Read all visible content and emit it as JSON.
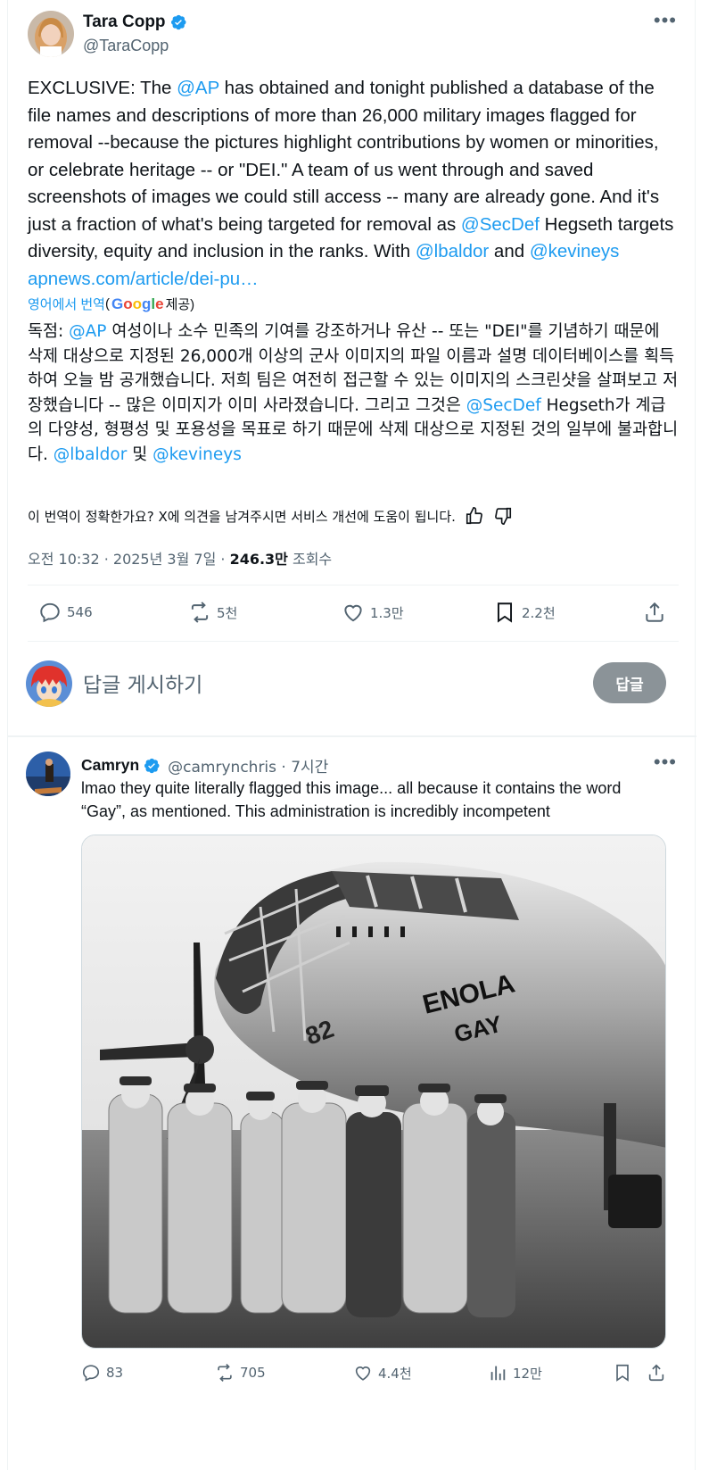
{
  "main_tweet": {
    "display_name": "Tara Copp",
    "handle": "@TaraCopp",
    "text_segments": [
      {
        "t": "EXCLUSIVE: The ",
        "link": false
      },
      {
        "t": "@AP",
        "link": true
      },
      {
        "t": "  has obtained and tonight published a database of the file names and descriptions of more than 26,000 military images flagged for removal --because the pictures highlight contributions by women or minorities, or celebrate heritage -- or \"DEI.\" A team of us went through and saved screenshots of images we could still access -- many are already gone. And it's just a fraction of what's being targeted for removal as ",
        "link": false
      },
      {
        "t": "@SecDef",
        "link": true
      },
      {
        "t": " Hegseth targets diversity, equity and inclusion in the ranks. With ",
        "link": false
      },
      {
        "t": "@lbaldor",
        "link": true
      },
      {
        "t": " and ",
        "link": false
      },
      {
        "t": "@kevineys",
        "link": true
      },
      {
        "t": " ",
        "link": false
      },
      {
        "t": "apnews.com/article/dei-pu…",
        "link": true
      }
    ],
    "translate_label": "영어에서 번역",
    "translate_paren_open": "(",
    "google_letters": [
      "G",
      "o",
      "o",
      "g",
      "l",
      "e"
    ],
    "translate_provided": " 제공)",
    "ko_segments": [
      {
        "t": "독점: ",
        "link": false
      },
      {
        "t": "@AP",
        "link": true
      },
      {
        "t": " 여성이나 소수 민족의 기여를 강조하거나 유산 -- 또는 \"DEI\"를 기념하기 때문에 삭제 대상으로 지정된 26,000개 이상의 군사 이미지의 파일 이름과 설명 데이터베이스를 획득하여 오늘 밤 공개했습니다. 저희 팀은 여전히 접근할 수 있는 이미지의 스크린샷을 살펴보고 저장했습니다 -- 많은 이미지가 이미 사라졌습니다. 그리고 그것은 ",
        "link": false
      },
      {
        "t": "@SecDef",
        "link": true
      },
      {
        "t": " Hegseth가 계급의 다양성, 형평성 및 포용성을 목표로 하기 때문에 삭제 대상으로 지정된 것의 일부에 불과합니다. ",
        "link": false
      },
      {
        "t": "@lbaldor",
        "link": true
      },
      {
        "t": " 및 ",
        "link": false
      },
      {
        "t": "@kevineys",
        "link": true
      }
    ],
    "feedback_text": "이 번역이 정확한가요? X에 의견을 남겨주시면 서비스 개선에 도움이 됩니다.",
    "timestamp": "오전 10:32 · 2025년 3월 7일 · ",
    "views_count": "246.3만",
    "views_label": " 조회수",
    "stats": {
      "replies": "546",
      "reposts": "5천",
      "likes": "1.3만",
      "bookmarks": "2.2천"
    },
    "more_icon": "more-horizontal-icon"
  },
  "compose": {
    "placeholder": "답글 게시하기",
    "button_label": "답글"
  },
  "reply_tweet": {
    "display_name": "Camryn",
    "handle_time": "@camrynchris · 7시간",
    "text": "lmao they quite literally flagged this image... all because it contains the word “Gay”, as mentioned. This administration is incredibly incompetent",
    "image_nose_text_1": "ENOLA",
    "image_nose_text_2": "GAY",
    "image_number": "82",
    "stats": {
      "replies": "83",
      "reposts": "705",
      "likes": "4.4천",
      "views": "12만"
    }
  },
  "colors": {
    "link": "#1d9bf0",
    "muted": "#536471",
    "text": "#0f1419",
    "verified": "#1d9bf0",
    "reply_button": "#8b9398"
  }
}
